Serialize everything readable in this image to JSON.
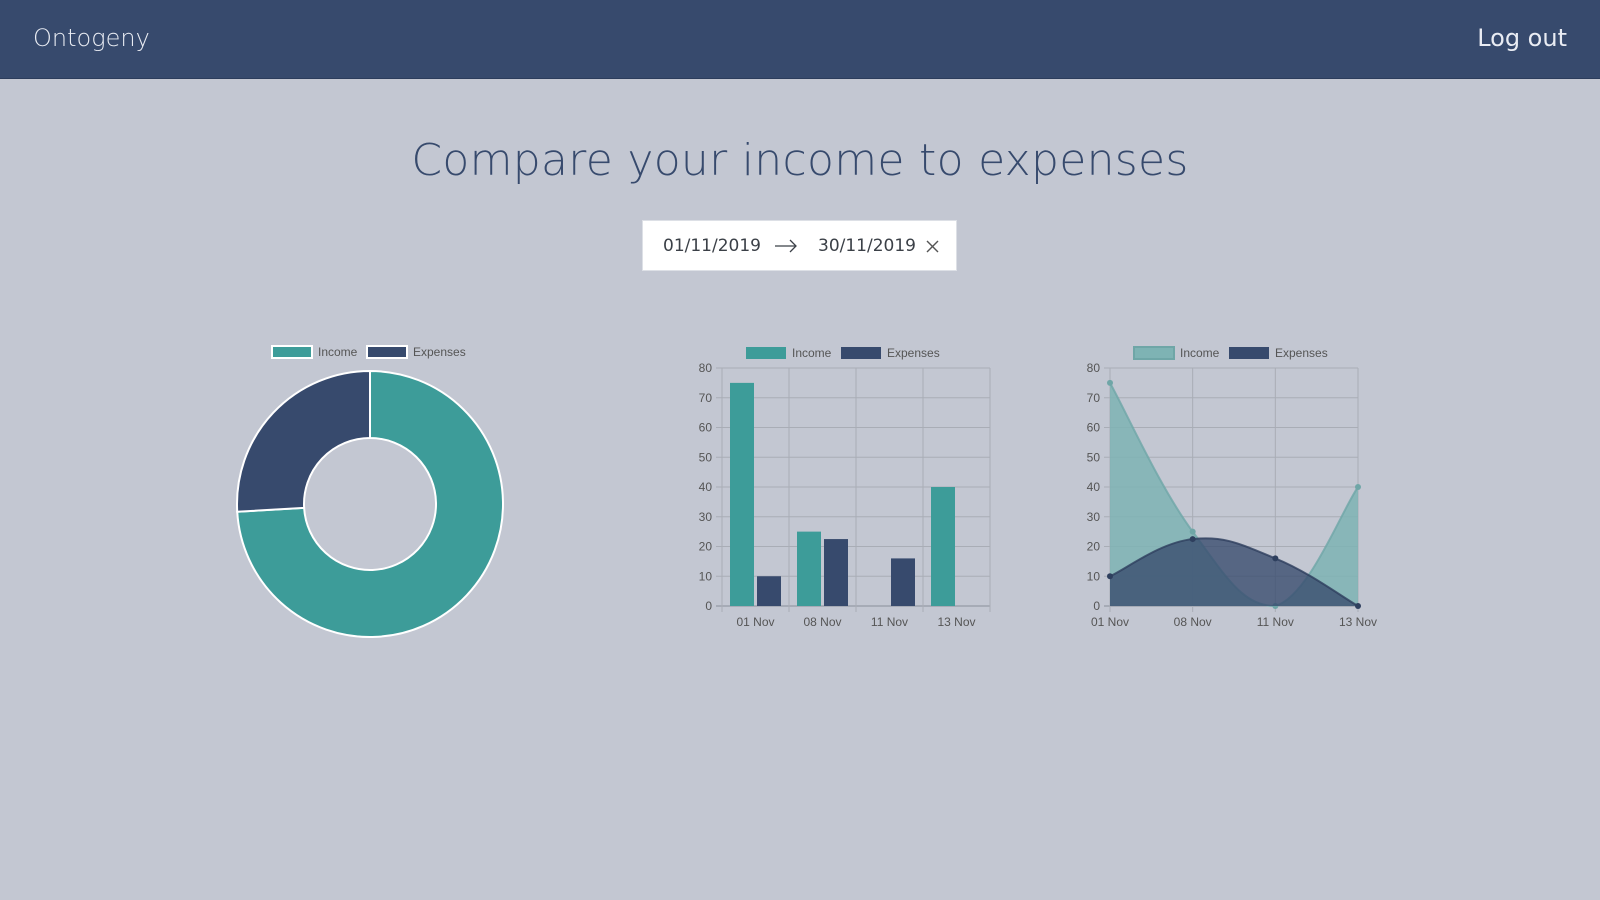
{
  "header": {
    "brand": "Ontogeny",
    "logout_label": "Log out"
  },
  "main": {
    "title": "Compare your income to expenses",
    "date_range": {
      "start": "01/11/2019",
      "end": "30/11/2019"
    }
  },
  "colors": {
    "income": "#3d9c99",
    "expenses": "#374a6d",
    "income_area": "#7eb3b4"
  },
  "icons": {
    "arrow": "arrow-right-icon",
    "clear": "close-icon"
  },
  "chart_data": [
    {
      "type": "pie",
      "legend": [
        "Income",
        "Expenses"
      ],
      "legend_position": "top",
      "values": [
        140,
        49
      ],
      "labels": [
        "Income",
        "Expenses"
      ]
    },
    {
      "type": "bar",
      "legend_position": "top",
      "categories": [
        "01 Nov",
        "08 Nov",
        "11 Nov",
        "13 Nov"
      ],
      "series": [
        {
          "name": "Income",
          "values": [
            75,
            25,
            0,
            40
          ]
        },
        {
          "name": "Expenses",
          "values": [
            10,
            22.5,
            16,
            0
          ]
        }
      ],
      "ylim": [
        0,
        80
      ],
      "yticks": [
        "0",
        "10",
        "20",
        "30",
        "40",
        "50",
        "60",
        "70",
        "80"
      ],
      "grid": true
    },
    {
      "type": "area",
      "legend_position": "top",
      "categories": [
        "01 Nov",
        "08 Nov",
        "11 Nov",
        "13 Nov"
      ],
      "series": [
        {
          "name": "Income",
          "values": [
            75,
            25,
            0,
            40
          ]
        },
        {
          "name": "Expenses",
          "values": [
            10,
            22.5,
            16,
            0
          ]
        }
      ],
      "ylim": [
        0,
        80
      ],
      "yticks": [
        "0",
        "10",
        "20",
        "30",
        "40",
        "50",
        "60",
        "70",
        "80"
      ],
      "grid": true
    }
  ]
}
